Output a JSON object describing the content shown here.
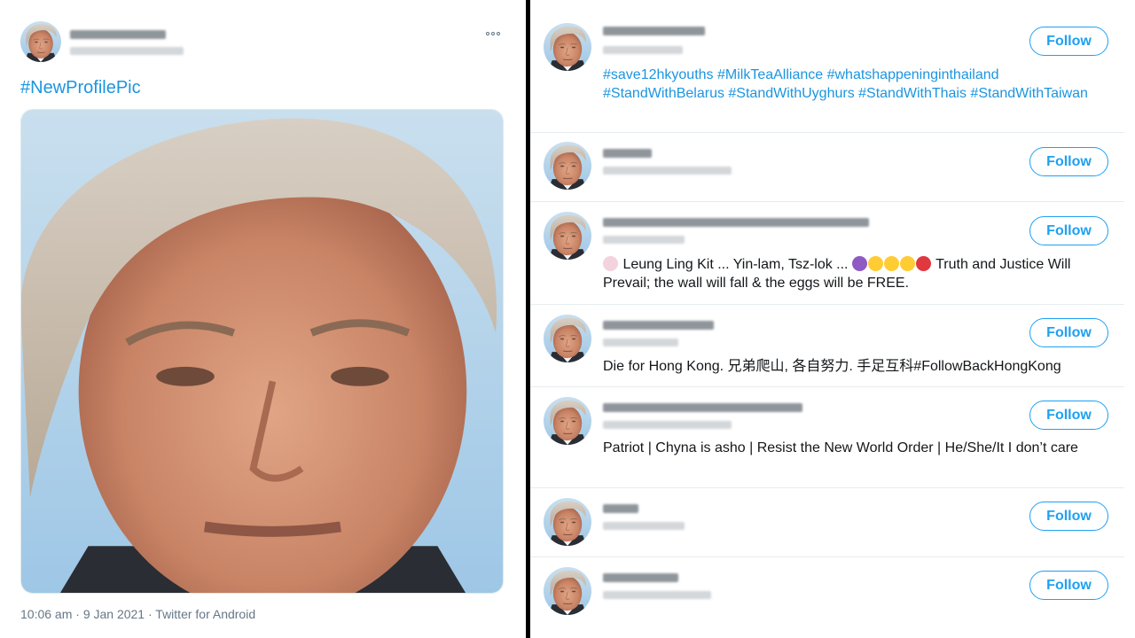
{
  "tweet": {
    "more_icon": "more-horizontal-icon",
    "hashtag": "#NewProfilePic",
    "meta": "10:06 am · 9 Jan 2021 · Twitter for Android",
    "photo_icon": "profile-photo-face"
  },
  "followers": {
    "follow_label": "Follow",
    "accent": "#1da1f2",
    "rows": [
      {
        "bio": "#save12hkyouths #MilkTeaAlliance #whatshappeninginthailand #StandWithBelarus #StandWithUyghurs #StandWithThais #StandWithTaiwan"
      },
      {
        "bio": ""
      },
      {
        "bio_part1": "Leung Ling Kit ... Yin-lam, Tsz-lok ...",
        "bio_part2": "Truth and Justice Will Prevail; the wall will fall & the eggs will be FREE."
      },
      {
        "bio": "Die for Hong Kong. 兄弟爬山, 各自努力. 手足互科#FollowBackHongKong"
      },
      {
        "bio": "Patriot | Chyna is asho | Resist the New World Order | He/She/It I don’t care"
      },
      {
        "bio": ""
      },
      {
        "bio": ""
      }
    ]
  }
}
